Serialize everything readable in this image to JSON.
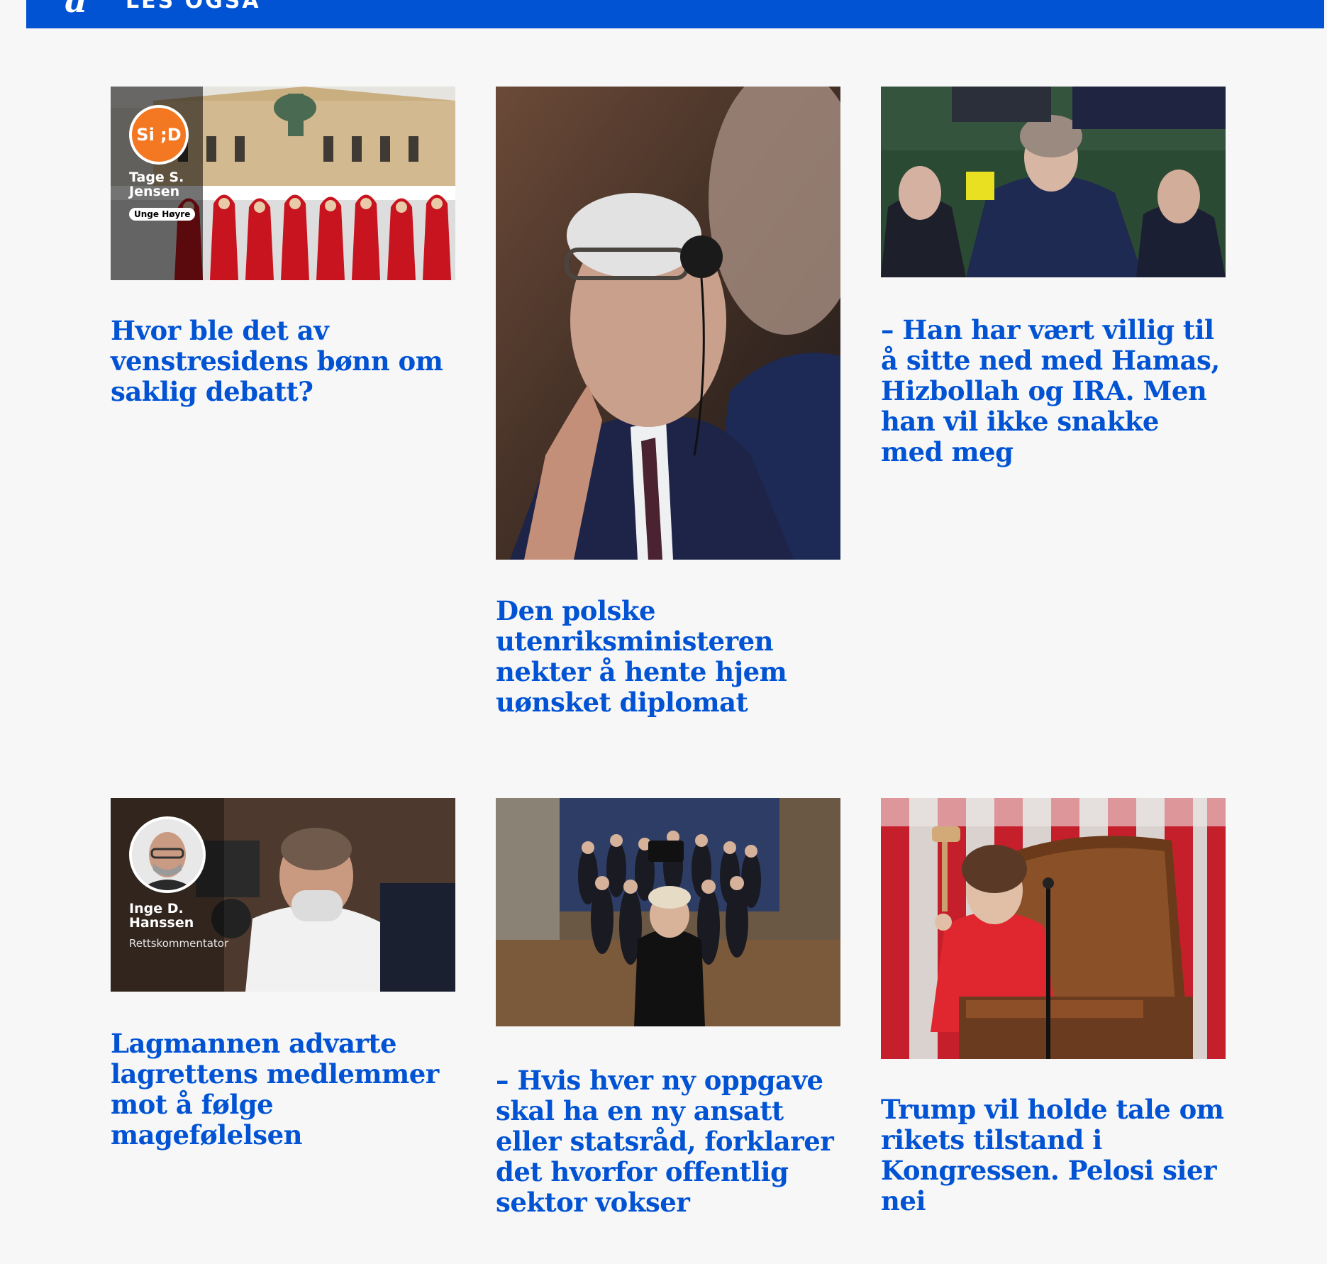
{
  "header": {
    "logo": "a",
    "section": "LES OGSÅ"
  },
  "articles": [
    {
      "title": "Hvor ble det av venstresidens bønn om saklig debatt?",
      "badge": "Si ;D",
      "author": "Tage S. Jensen",
      "author_tag": "Unge Høyre"
    },
    {
      "title": "Den polske utenriksministeren nekter å hente hjem uønsket diplomat"
    },
    {
      "title": "– Han har vært villig til å sitte ned med Hamas, Hizbollah og IRA. Men han vil ikke snakke med meg"
    },
    {
      "title": "Lagmannen advarte lagrettens medlemmer mot å følge magefølelsen",
      "author": "Inge D. Hanssen",
      "author_role": "Rettskommentator"
    },
    {
      "title": "– Hvis hver ny oppgave skal ha en ny ansatt eller statsråd, forklarer det hvorfor offentlig sektor vokser"
    },
    {
      "title": "Trump vil holde tale om rikets tilstand i Kongressen. Pelosi sier nei"
    }
  ],
  "colors": {
    "brand": "#0153d4",
    "background": "#f7f7f7",
    "badge": "#f47721"
  }
}
